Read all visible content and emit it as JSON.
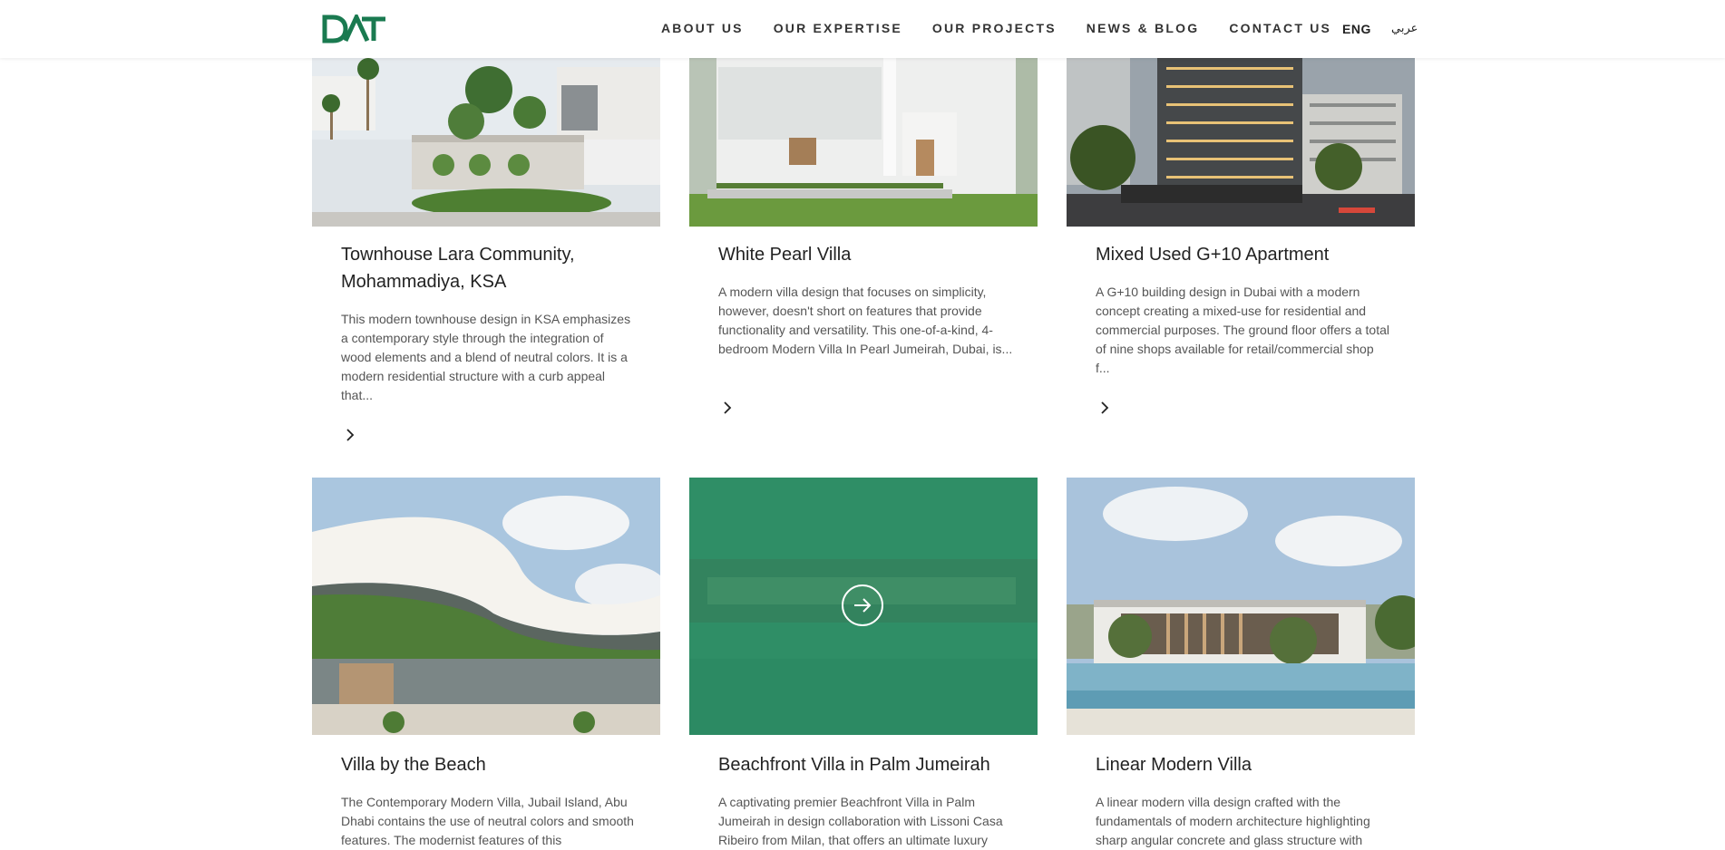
{
  "header": {
    "logo_text": "DAT",
    "nav": [
      "ABOUT US",
      "OUR EXPERTISE",
      "OUR PROJECTS",
      "NEWS & BLOG",
      "CONTACT US"
    ],
    "lang_eng": "ENG",
    "lang_ar": "عربي"
  },
  "colors": {
    "brand": "#1a7a50",
    "overlay": "#2b8a63"
  },
  "projects": [
    {
      "title": "Townhouse Lara Community, Mohammadiya, KSA",
      "description": "This modern townhouse design in KSA emphasizes a contemporary style through the integration of wood elements and a blend of neutral colors. It is a modern residential structure with a curb appeal that...",
      "more_icon": "chevron-right-icon"
    },
    {
      "title": "White Pearl Villa",
      "description": "A modern villa design that focuses on simplicity, however, doesn't short on features that provide functionality and versatility. This one-of-a-kind, 4-bedroom Modern Villa In Pearl Jumeirah, Dubai, is...",
      "more_icon": "chevron-right-icon"
    },
    {
      "title": "Mixed Used G+10 Apartment",
      "description": "A G+10 building design in Dubai with a modern concept creating a mixed-use for residential and commercial purposes. The ground floor offers a total of nine shops available for retail/commercial shop f...",
      "more_icon": "chevron-right-icon"
    },
    {
      "title": "Villa by the Beach",
      "description": "The Contemporary Modern Villa, Jubail Island, Abu Dhabi contains the use of neutral colors and smooth features. The modernist features of this"
    },
    {
      "title": "Beachfront Villa in Palm Jumeirah",
      "description": "A captivating premier Beachfront Villa in Palm Jumeirah in design collaboration with Lissoni Casa Ribeiro from Milan, that offers an ultimate luxury",
      "overlay_icon": "arrow-right-circle-icon"
    },
    {
      "title": "Linear Modern Villa",
      "description": "A linear modern villa design crafted with the fundamentals of modern architecture highlighting sharp angular concrete and glass structure with"
    }
  ]
}
